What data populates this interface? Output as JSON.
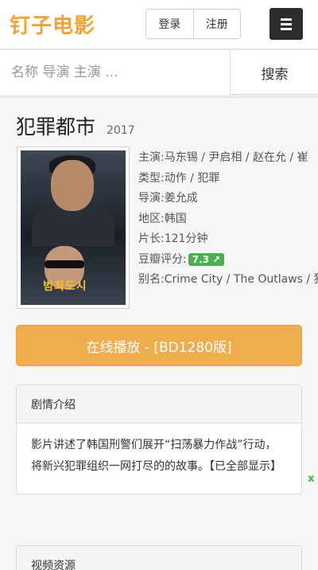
{
  "header": {
    "logo": "钉子电影",
    "login": "登录",
    "register": "注册"
  },
  "search": {
    "placeholder": "名称 导演 主演 ...",
    "button": "搜索"
  },
  "movie": {
    "title": "犯罪都市",
    "year": "2017",
    "poster_title": "범죄도시",
    "cast": "主演:马东锡 / 尹启相 / 赵在允 / 崔",
    "genre": "类型:动作 / 犯罪",
    "director": "导演:姜允成",
    "region": "地区:韩国",
    "runtime": "片长:121分钟",
    "rating_label": "豆瓣评分:",
    "rating": "7.3",
    "aka": "别名:Crime City / The Outlaws / 犯"
  },
  "play": {
    "label": "在线播放 - [BD1280版]"
  },
  "synopsis": {
    "heading": "剧情介绍",
    "text": "影片讲述了韩国刑警们展开“扫荡暴力作战”行动，将新兴犯罪组织一网打尽的的故事。【已全部显示】"
  },
  "resources": {
    "heading": "视频资源"
  },
  "side_badge": "x",
  "colors": {
    "accent": "#f0a33c",
    "play_button": "#f0ad4e",
    "rating_badge": "#4caf50",
    "menu_button": "#2c2c2c"
  }
}
